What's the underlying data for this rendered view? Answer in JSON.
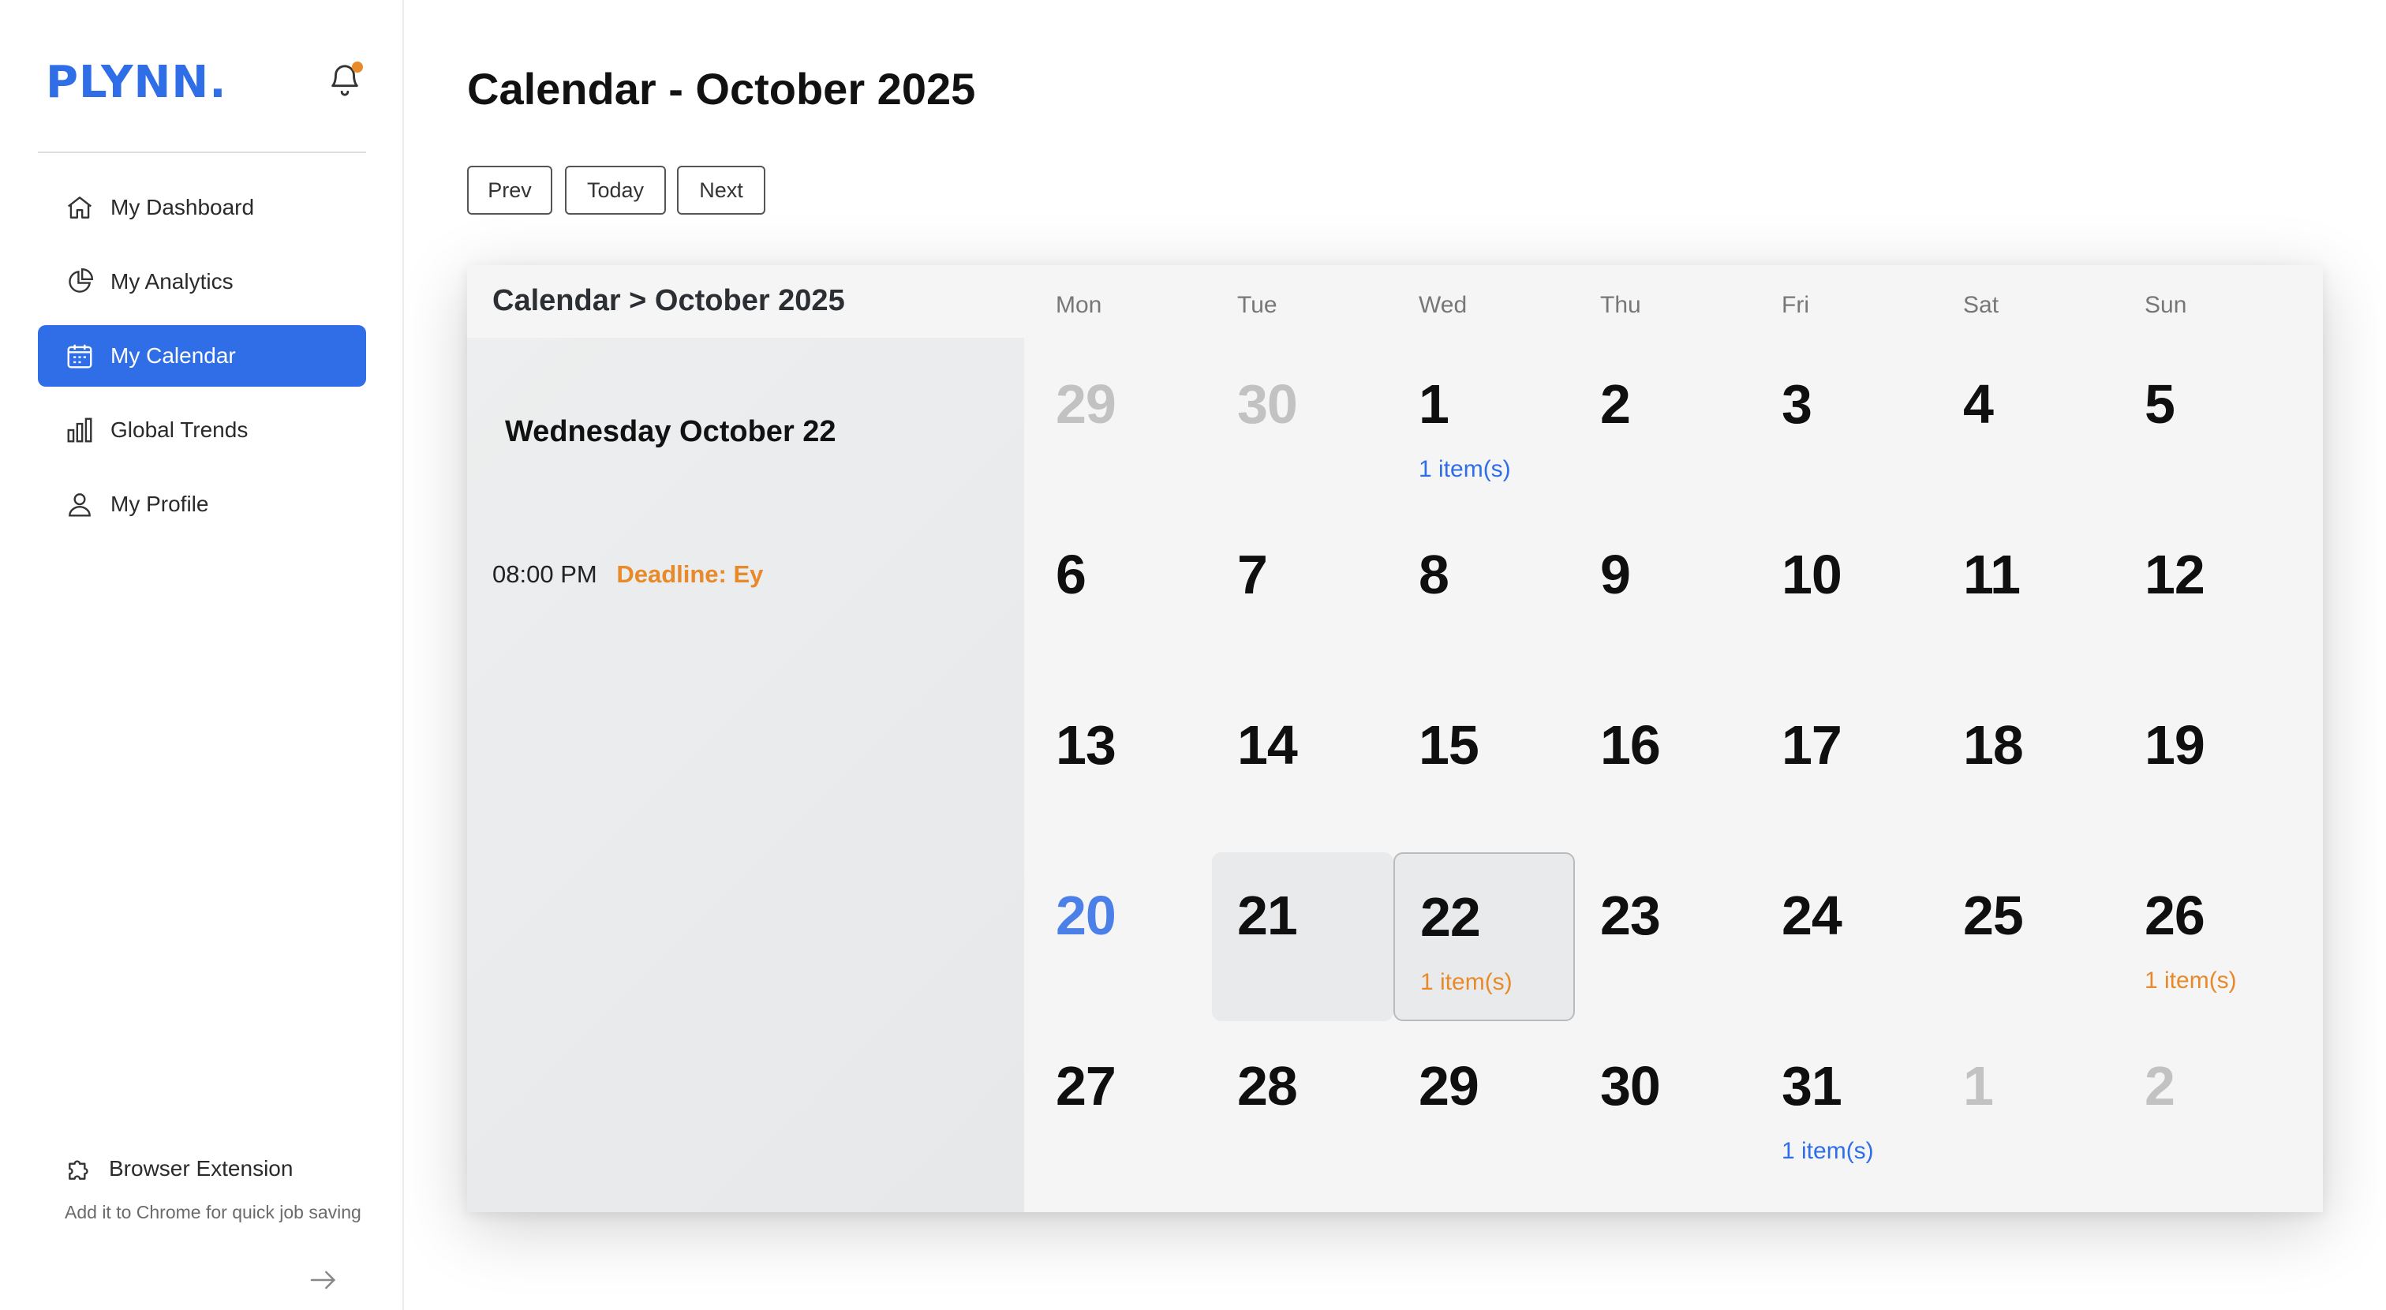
{
  "sidebar": {
    "logo": "PLYNN.",
    "nav": [
      {
        "label": "My Dashboard",
        "icon": "home-icon"
      },
      {
        "label": "My Analytics",
        "icon": "pie-chart-icon"
      },
      {
        "label": "My Calendar",
        "icon": "calendar-icon",
        "active": true
      },
      {
        "label": "Global Trends",
        "icon": "bar-chart-icon"
      },
      {
        "label": "My Profile",
        "icon": "user-icon"
      }
    ],
    "extension": {
      "title": "Browser Extension",
      "description": "Add it to Chrome for quick job saving",
      "icon": "puzzle-icon"
    }
  },
  "colors": {
    "accent": "#2f6ee6",
    "notification_dot": "#e8892a",
    "event_orange": "#e8892a",
    "today_blue": "#4a80e8"
  },
  "header": {
    "title": "Calendar - October 2025",
    "prev_label": "Prev",
    "today_label": "Today",
    "next_label": "Next"
  },
  "calendar": {
    "breadcrumb": "Calendar > October 2025",
    "selected_date_label": "Wednesday October 22",
    "events": [
      {
        "time": "08:00 PM",
        "title": "Deadline: Ey"
      }
    ],
    "weekdays": [
      "Mon",
      "Tue",
      "Wed",
      "Thu",
      "Fri",
      "Sat",
      "Sun"
    ],
    "weeks": [
      [
        {
          "day": "29",
          "muted": true
        },
        {
          "day": "30",
          "muted": true
        },
        {
          "day": "1",
          "items": "1 item(s)",
          "items_color": "blue"
        },
        {
          "day": "2"
        },
        {
          "day": "3"
        },
        {
          "day": "4"
        },
        {
          "day": "5"
        }
      ],
      [
        {
          "day": "6"
        },
        {
          "day": "7"
        },
        {
          "day": "8"
        },
        {
          "day": "9"
        },
        {
          "day": "10"
        },
        {
          "day": "11"
        },
        {
          "day": "12"
        }
      ],
      [
        {
          "day": "13"
        },
        {
          "day": "14"
        },
        {
          "day": "15"
        },
        {
          "day": "16"
        },
        {
          "day": "17"
        },
        {
          "day": "18"
        },
        {
          "day": "19"
        }
      ],
      [
        {
          "day": "20",
          "today": true
        },
        {
          "day": "21",
          "highlight": true
        },
        {
          "day": "22",
          "selected": true,
          "items": "1 item(s)",
          "items_color": "orange"
        },
        {
          "day": "23"
        },
        {
          "day": "24"
        },
        {
          "day": "25"
        },
        {
          "day": "26",
          "items": "1 item(s)",
          "items_color": "orange"
        }
      ],
      [
        {
          "day": "27"
        },
        {
          "day": "28"
        },
        {
          "day": "29"
        },
        {
          "day": "30"
        },
        {
          "day": "31",
          "items": "1 item(s)",
          "items_color": "blue"
        },
        {
          "day": "1",
          "muted": true
        },
        {
          "day": "2",
          "muted": true
        }
      ]
    ]
  }
}
